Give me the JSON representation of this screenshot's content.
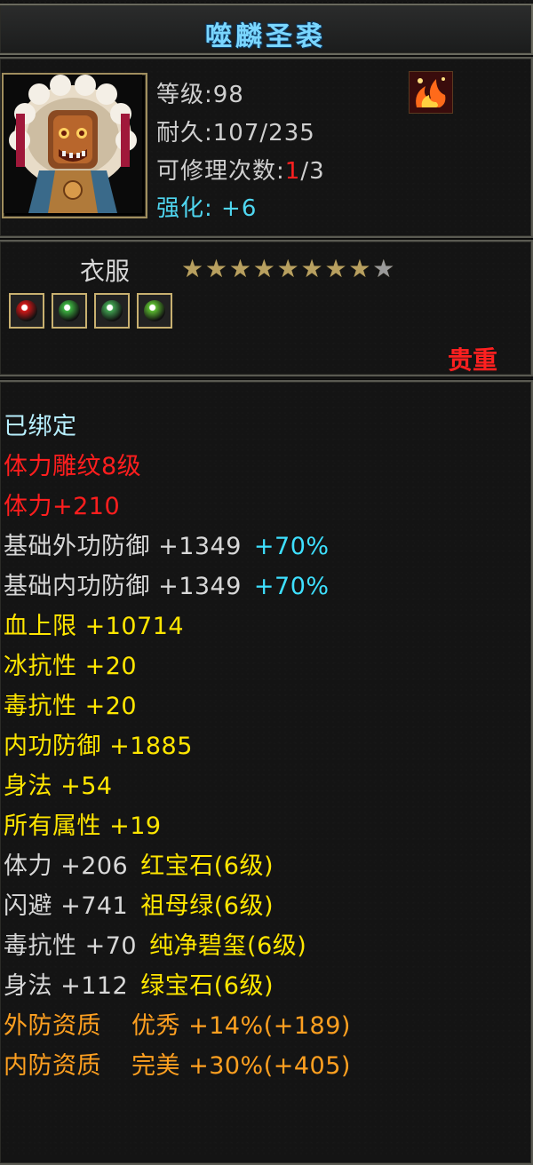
{
  "item": {
    "name": "噬麟圣裘",
    "level_label": "等级:",
    "level": "98",
    "durability_label": "耐久:",
    "durability": "107/235",
    "repair_label": "可修理次数:",
    "repair_current": "1",
    "repair_max": "/3",
    "enhance_label": "强化:",
    "enhance_value": "+6",
    "type": "衣服",
    "stars_total": 9,
    "stars_filled": 8,
    "gem_colors": [
      "#d01818",
      "#3cb040",
      "#40a050",
      "#5ab830"
    ],
    "rarity": "贵重",
    "icons": {
      "portrait": "armor-portrait-icon",
      "rare": "rare-fire-icon",
      "star": "star-icon"
    }
  },
  "attributes": [
    {
      "text": "已绑定",
      "color": "cyan"
    },
    {
      "text": "体力雕纹8级",
      "color": "red"
    },
    {
      "text": "体力+210",
      "color": "red"
    },
    {
      "text": "基础外功防御 +1349",
      "extra": "+70%",
      "color": "white"
    },
    {
      "text": "基础内功防御 +1349",
      "extra": "+70%",
      "color": "white"
    },
    {
      "text": "血上限 +10714",
      "color": "yellow"
    },
    {
      "text": "冰抗性 +20",
      "color": "yellow"
    },
    {
      "text": "毒抗性 +20",
      "color": "yellow"
    },
    {
      "text": "内功防御 +1885",
      "color": "yellow"
    },
    {
      "text": "身法 +54",
      "color": "yellow"
    },
    {
      "text": "所有属性 +19",
      "color": "yellow"
    },
    {
      "text": "体力 +206",
      "gem": "红宝石(6级)",
      "color": "white"
    },
    {
      "text": "闪避 +741",
      "gem": "祖母绿(6级)",
      "color": "white"
    },
    {
      "text": "毒抗性 +70",
      "gem": "纯净碧玺(6级)",
      "color": "white"
    },
    {
      "text": "身法 +112",
      "gem": "绿宝石(6级)",
      "color": "white"
    },
    {
      "text": "外防资质",
      "grade": "优秀 +14%(+189)",
      "color": "orange"
    },
    {
      "text": "内防资质",
      "grade": "完美 +30%(+405)",
      "color": "orange"
    }
  ]
}
